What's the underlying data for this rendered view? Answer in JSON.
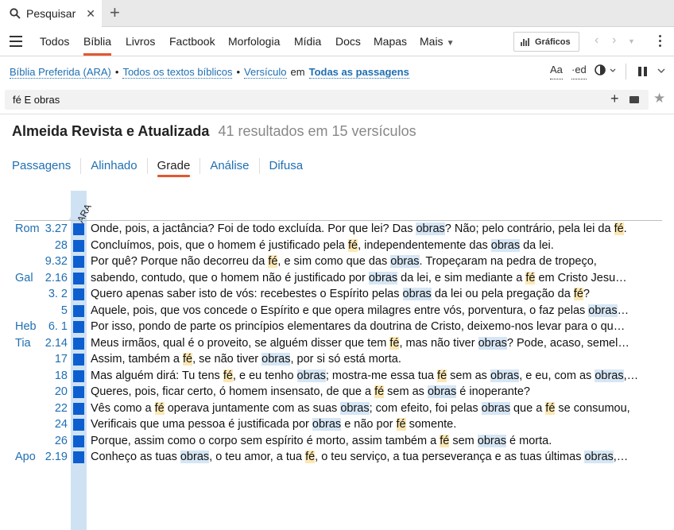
{
  "tab": {
    "label": "Pesquisar",
    "close": "✕",
    "new": "+"
  },
  "nav": {
    "items": [
      "Todos",
      "Bíblia",
      "Livros",
      "Factbook",
      "Morfologia",
      "Mídia",
      "Docs",
      "Mapas",
      "Mais"
    ],
    "active": "Bíblia",
    "graficos": "Gráficos"
  },
  "context": {
    "bible": "Bíblia Preferida (ARA)",
    "bullet1": "•",
    "scope": "Todos os textos bíblicos",
    "bullet2": "•",
    "unit": "Versículo",
    "em": "em",
    "where": "Todas as passagens",
    "font_icon": "Aa",
    "ed_icon": "·ed"
  },
  "search": {
    "value": "fé E obras",
    "placeholder": ""
  },
  "heading": {
    "title": "Almeida Revista e Atualizada",
    "count": "41 resultados em 15 versículos"
  },
  "views": [
    "Passagens",
    "Alinhado",
    "Grade",
    "Análise",
    "Difusa"
  ],
  "active_view": "Grade",
  "column_label": "ARA",
  "accent": "#e4572e",
  "link_color": "#1f6fb2",
  "mark_color": "#0d5fcf",
  "rows": [
    {
      "book": "Rom",
      "num": "3.27",
      "segs": [
        [
          "Onde, pois, a jactância? Foi de todo excluída. Por que lei? Das ",
          ""
        ],
        [
          "obras",
          "o"
        ],
        [
          "? Não; pelo contrário, pela lei da ",
          ""
        ],
        [
          "fé",
          "f"
        ],
        [
          ".",
          ""
        ]
      ]
    },
    {
      "book": "",
      "num": "28",
      "segs": [
        [
          "Concluímos, pois, que o homem é justificado pela ",
          ""
        ],
        [
          "fé",
          "f"
        ],
        [
          ", independentemente das ",
          ""
        ],
        [
          "obras",
          "o"
        ],
        [
          " da lei.",
          ""
        ]
      ]
    },
    {
      "book": "",
      "num": "9.32",
      "segs": [
        [
          "Por quê? Porque não decorreu da ",
          ""
        ],
        [
          "fé",
          "f"
        ],
        [
          ", e sim como que das ",
          ""
        ],
        [
          "obras",
          "o"
        ],
        [
          ". Tropeçaram na pedra de tropeço,",
          ""
        ]
      ]
    },
    {
      "book": "Gal",
      "num": "2.16",
      "segs": [
        [
          "sabendo, contudo, que o homem não é justificado por ",
          ""
        ],
        [
          "obras",
          "o"
        ],
        [
          " da lei, e sim mediante a ",
          ""
        ],
        [
          "fé",
          "f"
        ],
        [
          " em Cristo Jesu…",
          ""
        ]
      ]
    },
    {
      "book": "",
      "num": "3.  2",
      "segs": [
        [
          "Quero apenas saber isto de vós: recebestes o Espírito pelas ",
          ""
        ],
        [
          "obras",
          "o"
        ],
        [
          " da lei ou pela pregação da ",
          ""
        ],
        [
          "fé",
          "f"
        ],
        [
          "?",
          ""
        ]
      ]
    },
    {
      "book": "",
      "num": "5",
      "segs": [
        [
          "Aquele, pois, que vos concede o Espírito e que opera milagres entre vós, porventura, o faz pelas ",
          ""
        ],
        [
          "obras",
          "o"
        ],
        [
          "…",
          ""
        ]
      ]
    },
    {
      "book": "Heb",
      "num": "6.  1",
      "segs": [
        [
          "Por isso, pondo de parte os princípios elementares da doutrina de Cristo, deixemo-nos levar para o qu…",
          ""
        ]
      ]
    },
    {
      "book": "Tia",
      "num": "2.14",
      "segs": [
        [
          "Meus irmãos, qual é o proveito, se alguém disser que tem ",
          ""
        ],
        [
          "fé",
          "f"
        ],
        [
          ", mas não tiver ",
          ""
        ],
        [
          "obras",
          "o"
        ],
        [
          "? Pode, acaso, semel…",
          ""
        ]
      ]
    },
    {
      "book": "",
      "num": "17",
      "segs": [
        [
          "Assim, também a ",
          ""
        ],
        [
          "fé",
          "f"
        ],
        [
          ", se não tiver ",
          ""
        ],
        [
          "obras",
          "o"
        ],
        [
          ", por si só está morta.",
          ""
        ]
      ]
    },
    {
      "book": "",
      "num": "18",
      "segs": [
        [
          "Mas alguém dirá: Tu tens ",
          ""
        ],
        [
          "fé",
          "f"
        ],
        [
          ", e eu tenho ",
          ""
        ],
        [
          "obras",
          "o"
        ],
        [
          "; mostra-me essa tua ",
          ""
        ],
        [
          "fé",
          "f"
        ],
        [
          " sem as ",
          ""
        ],
        [
          "obras",
          "o"
        ],
        [
          ", e eu, com as ",
          ""
        ],
        [
          "obras",
          "o"
        ],
        [
          ",…",
          ""
        ]
      ]
    },
    {
      "book": "",
      "num": "20",
      "segs": [
        [
          "Queres, pois, ficar certo, ó homem insensato, de que a ",
          ""
        ],
        [
          "fé",
          "f"
        ],
        [
          " sem as ",
          ""
        ],
        [
          "obras",
          "o"
        ],
        [
          " é inoperante?",
          ""
        ]
      ]
    },
    {
      "book": "",
      "num": "22",
      "segs": [
        [
          "Vês como a ",
          ""
        ],
        [
          "fé",
          "f"
        ],
        [
          " operava juntamente com as suas ",
          ""
        ],
        [
          "obras",
          "o"
        ],
        [
          "; com efeito, foi pelas ",
          ""
        ],
        [
          "obras",
          "o"
        ],
        [
          " que a ",
          ""
        ],
        [
          "fé",
          "f"
        ],
        [
          " se consumou,",
          ""
        ]
      ]
    },
    {
      "book": "",
      "num": "24",
      "segs": [
        [
          "Verificais que uma pessoa é justificada por ",
          ""
        ],
        [
          "obras",
          "o"
        ],
        [
          " e não por ",
          ""
        ],
        [
          "fé",
          "f"
        ],
        [
          " somente.",
          ""
        ]
      ]
    },
    {
      "book": "",
      "num": "26",
      "segs": [
        [
          "Porque, assim como o corpo sem espírito é morto, assim também a ",
          ""
        ],
        [
          "fé",
          "f"
        ],
        [
          " sem ",
          ""
        ],
        [
          "obras",
          "o"
        ],
        [
          " é morta.",
          ""
        ]
      ]
    },
    {
      "book": "Apo",
      "num": "2.19",
      "segs": [
        [
          "Conheço as tuas ",
          ""
        ],
        [
          "obras",
          "o"
        ],
        [
          ", o teu amor, a tua ",
          ""
        ],
        [
          "fé",
          "f"
        ],
        [
          ", o teu serviço, a tua perseverança e as tuas últimas ",
          ""
        ],
        [
          "obras",
          "o"
        ],
        [
          ",…",
          ""
        ]
      ]
    }
  ]
}
